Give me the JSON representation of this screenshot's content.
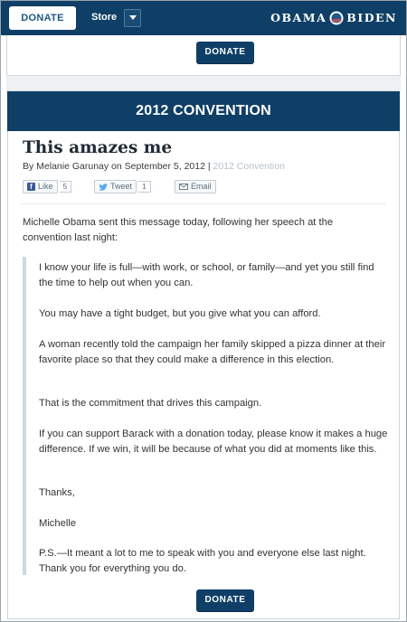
{
  "nav": {
    "donate_label": "DONATE",
    "store_label": "Store",
    "logo_left": "OBAMA",
    "logo_right": "BIDEN"
  },
  "donate_top_label": "DONATE",
  "donate_bottom_label": "DONATE",
  "banner_text": "2012 CONVENTION",
  "post": {
    "title": "This amazes me",
    "byline": "By Melanie Garunay on September 5, 2012 | ",
    "category": "2012 Convention"
  },
  "share": {
    "like_label": "Like",
    "like_count": "5",
    "tweet_label": "Tweet",
    "tweet_count": "1",
    "email_label": "Email"
  },
  "body": {
    "intro": "Michelle Obama sent this message today, following her speech at the convention last night:",
    "quote": [
      "I know your life is full—with work, or school, or family—and yet you still find the time to help out when you can.",
      "You may have a tight budget, but you give what you can afford.",
      "A woman recently told the campaign her family skipped a pizza dinner at their favorite place so that they could make a difference in this election.",
      "That is the commitment that drives this campaign.",
      "If you can support Barack with a donation today, please know it makes a huge difference. If we win, it will be because of what you did at moments like this.",
      "Thanks,",
      "Michelle",
      "P.S.—It meant a lot to me to speak with you and everyone else last night. Thank you for everything you do."
    ]
  },
  "colors": {
    "brand_navy": "#0f3f66",
    "quote_bar": "#c9d9e5",
    "category_gray": "#b7c1c9"
  }
}
